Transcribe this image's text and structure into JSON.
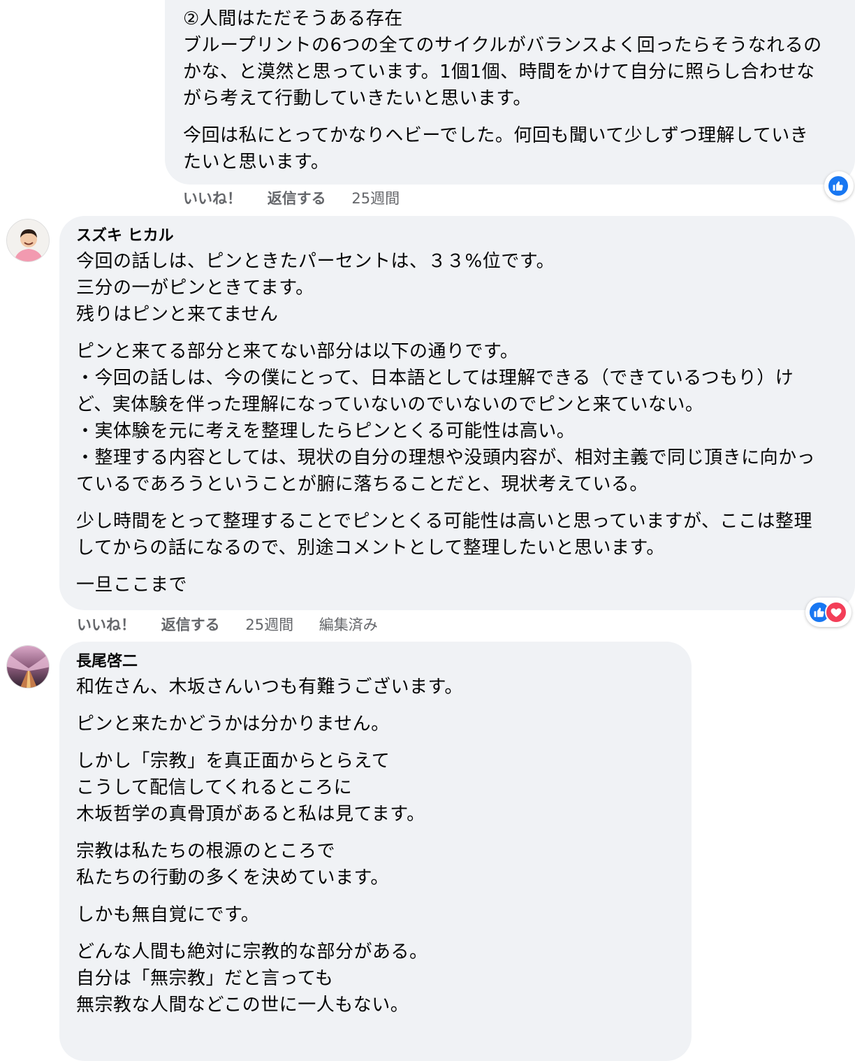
{
  "comments": [
    {
      "paragraphs": [
        [
          "②人間はただそうある存在",
          "ブループリントの6つの全てのサイクルがバランスよく回ったらそうなれるの",
          "かな、と漠然と思っています。1個1個、時間をかけて自分に照らし合わせな",
          "がら考えて行動していきたいと思います。"
        ],
        [
          "今回は私にとってかなりヘビーでした。何回も聞いて少しずつ理解していき",
          "たいと思います。"
        ]
      ],
      "actions": {
        "like": "いいね！",
        "reply": "返信する",
        "time": "25週間"
      },
      "reactions": [
        "like"
      ]
    },
    {
      "author": "スズキ ヒカル",
      "paragraphs": [
        [
          "今回の話しは、ピンときたパーセントは、３３%位です。",
          "三分の一がピンときてます。",
          "残りはピンと来てません"
        ],
        [
          "ピンと来てる部分と来てない部分は以下の通りです。",
          "・今回の話しは、今の僕にとって、日本語としては理解できる（できているつもり）け",
          "ど、実体験を伴った理解になっていないのでいないのでピンと来ていない。",
          "・実体験を元に考えを整理したらピンとくる可能性は高い。",
          "・整理する内容としては、現状の自分の理想や没頭内容が、相対主義で同じ頂きに向かっ",
          "ているであろうということが腑に落ちることだと、現状考えている。"
        ],
        [
          "少し時間をとって整理することでピンとくる可能性は高いと思っていますが、ここは整理",
          "してからの話になるので、別途コメントとして整理したいと思います。"
        ],
        [
          "一旦ここまで"
        ]
      ],
      "actions": {
        "like": "いいね！",
        "reply": "返信する",
        "time": "25週間",
        "edited": "編集済み"
      },
      "reactions": [
        "like",
        "love"
      ]
    },
    {
      "author": "長尾啓二",
      "paragraphs": [
        [
          "和佐さん、木坂さんいつも有難うございます。"
        ],
        [
          "ピンと来たかどうかは分かりません。"
        ],
        [
          "しかし「宗教」を真正面からとらえて",
          "こうして配信してくれるところに",
          "木坂哲学の真骨頂があると私は見てます。"
        ],
        [
          "宗教は私たちの根源のところで",
          "私たちの行動の多くを決めています。"
        ],
        [
          "しかも無自覚にです。"
        ],
        [
          "どんな人間も絶対に宗教的な部分がある。",
          "自分は「無宗教」だと言っても",
          "無宗教な人間などこの世に一人もない。"
        ]
      ]
    }
  ]
}
